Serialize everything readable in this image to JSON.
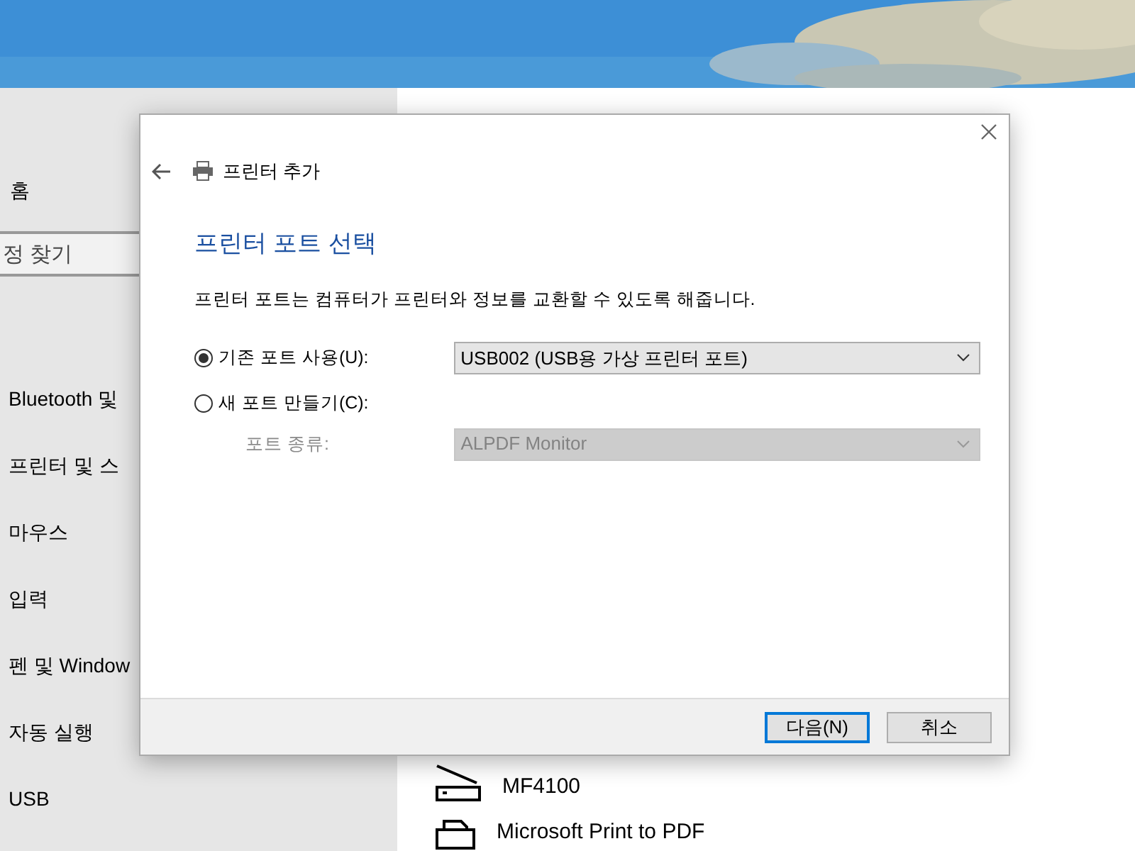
{
  "sidebar": {
    "home": "홈",
    "search": {
      "placeholder": "정 찾기"
    },
    "items": [
      "Bluetooth 및",
      "프린터 및 스",
      "마우스",
      "입력",
      "펜 및 Window",
      "자동 실행",
      "USB"
    ]
  },
  "devices": [
    {
      "kind": "scanner",
      "name": "MF4100"
    },
    {
      "kind": "printer",
      "name": "Microsoft Print to PDF"
    }
  ],
  "dialog": {
    "title": "프린터 추가",
    "heading": "프린터 포트 선택",
    "description": "프린터 포트는 컴퓨터가 프린터와 정보를 교환할 수 있도록 해줍니다.",
    "options": [
      {
        "label": "기존 포트 사용(U):",
        "selected": true,
        "value": "USB002 (USB용 가상 프린터 포트)",
        "disabled": false
      },
      {
        "label": "새 포트 만들기(C):",
        "selected": false,
        "sub_label": "포트 종류:",
        "value": "ALPDF Monitor",
        "disabled": true
      }
    ],
    "buttons": [
      {
        "label": "다음(N)",
        "default": true
      },
      {
        "label": "취소",
        "default": false
      }
    ]
  }
}
